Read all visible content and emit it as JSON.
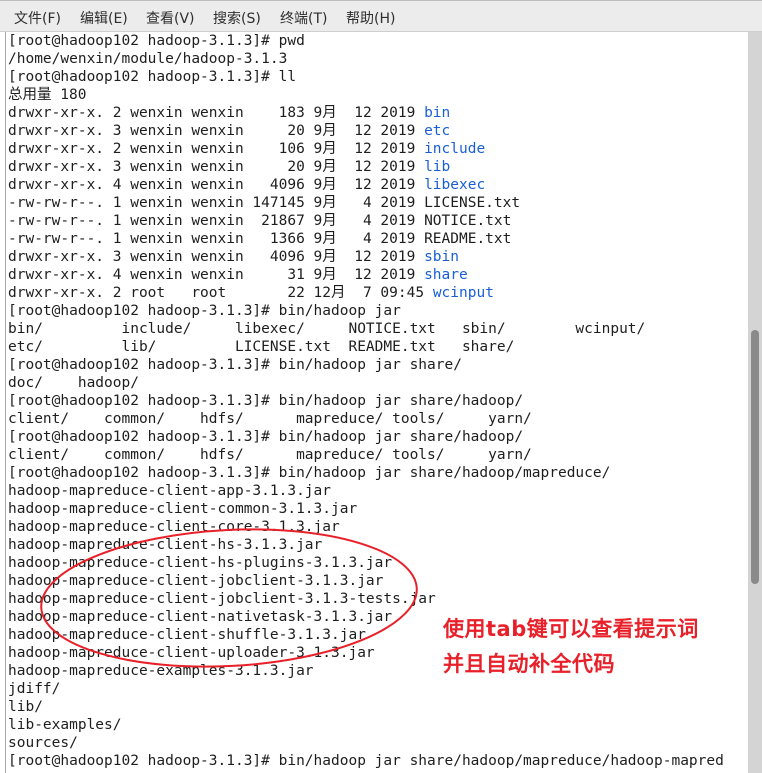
{
  "menu": [
    "文件(F)",
    "编辑(E)",
    "查看(V)",
    "搜索(S)",
    "终端(T)",
    "帮助(H)"
  ],
  "terminal_lines": [
    [
      {
        "t": "[root@hadoop102 hadoop-3.1.3]# pwd"
      }
    ],
    [
      {
        "t": "/home/wenxin/module/hadoop-3.1.3"
      }
    ],
    [
      {
        "t": "[root@hadoop102 hadoop-3.1.3]# ll"
      }
    ],
    [
      {
        "t": "总用量 180"
      }
    ],
    [
      {
        "t": "drwxr-xr-x. 2 wenxin wenxin    183 9月  12 2019 "
      },
      {
        "t": "bin",
        "c": "blue"
      }
    ],
    [
      {
        "t": "drwxr-xr-x. 3 wenxin wenxin     20 9月  12 2019 "
      },
      {
        "t": "etc",
        "c": "blue"
      }
    ],
    [
      {
        "t": "drwxr-xr-x. 2 wenxin wenxin    106 9月  12 2019 "
      },
      {
        "t": "include",
        "c": "blue"
      }
    ],
    [
      {
        "t": "drwxr-xr-x. 3 wenxin wenxin     20 9月  12 2019 "
      },
      {
        "t": "lib",
        "c": "blue"
      }
    ],
    [
      {
        "t": "drwxr-xr-x. 4 wenxin wenxin   4096 9月  12 2019 "
      },
      {
        "t": "libexec",
        "c": "blue"
      }
    ],
    [
      {
        "t": "-rw-rw-r--. 1 wenxin wenxin 147145 9月   4 2019 LICENSE.txt"
      }
    ],
    [
      {
        "t": "-rw-rw-r--. 1 wenxin wenxin  21867 9月   4 2019 NOTICE.txt"
      }
    ],
    [
      {
        "t": "-rw-rw-r--. 1 wenxin wenxin   1366 9月   4 2019 README.txt"
      }
    ],
    [
      {
        "t": "drwxr-xr-x. 3 wenxin wenxin   4096 9月  12 2019 "
      },
      {
        "t": "sbin",
        "c": "blue"
      }
    ],
    [
      {
        "t": "drwxr-xr-x. 4 wenxin wenxin     31 9月  12 2019 "
      },
      {
        "t": "share",
        "c": "blue"
      }
    ],
    [
      {
        "t": "drwxr-xr-x. 2 root   root       22 12月  7 09:45 "
      },
      {
        "t": "wcinput",
        "c": "blue"
      }
    ],
    [
      {
        "t": "[root@hadoop102 hadoop-3.1.3]# bin/hadoop jar"
      }
    ],
    [
      {
        "t": "bin/         include/     libexec/     NOTICE.txt   sbin/        wcinput/"
      }
    ],
    [
      {
        "t": "etc/         lib/         LICENSE.txt  README.txt   share/"
      }
    ],
    [
      {
        "t": "[root@hadoop102 hadoop-3.1.3]# bin/hadoop jar share/"
      }
    ],
    [
      {
        "t": "doc/    hadoop/"
      }
    ],
    [
      {
        "t": "[root@hadoop102 hadoop-3.1.3]# bin/hadoop jar share/hadoop/"
      }
    ],
    [
      {
        "t": "client/    common/    hdfs/      mapreduce/ tools/     yarn/"
      }
    ],
    [
      {
        "t": "[root@hadoop102 hadoop-3.1.3]# bin/hadoop jar share/hadoop/"
      }
    ],
    [
      {
        "t": "client/    common/    hdfs/      mapreduce/ tools/     yarn/"
      }
    ],
    [
      {
        "t": "[root@hadoop102 hadoop-3.1.3]# bin/hadoop jar share/hadoop/mapreduce/"
      }
    ],
    [
      {
        "t": "hadoop-mapreduce-client-app-3.1.3.jar"
      }
    ],
    [
      {
        "t": "hadoop-mapreduce-client-common-3.1.3.jar"
      }
    ],
    [
      {
        "t": "hadoop-mapreduce-client-core-3.1.3.jar"
      }
    ],
    [
      {
        "t": "hadoop-mapreduce-client-hs-3.1.3.jar"
      }
    ],
    [
      {
        "t": "hadoop-mapreduce-client-hs-plugins-3.1.3.jar"
      }
    ],
    [
      {
        "t": "hadoop-mapreduce-client-jobclient-3.1.3.jar"
      }
    ],
    [
      {
        "t": "hadoop-mapreduce-client-jobclient-3.1.3-tests.jar"
      }
    ],
    [
      {
        "t": "hadoop-mapreduce-client-nativetask-3.1.3.jar"
      }
    ],
    [
      {
        "t": "hadoop-mapreduce-client-shuffle-3.1.3.jar"
      }
    ],
    [
      {
        "t": "hadoop-mapreduce-client-uploader-3.1.3.jar"
      }
    ],
    [
      {
        "t": "hadoop-mapreduce-examples-3.1.3.jar"
      }
    ],
    [
      {
        "t": "jdiff/"
      }
    ],
    [
      {
        "t": "lib/"
      }
    ],
    [
      {
        "t": "lib-examples/"
      }
    ],
    [
      {
        "t": "sources/"
      }
    ],
    [
      {
        "t": "[root@hadoop102 hadoop-3.1.3]# bin/hadoop jar share/hadoop/mapreduce/hadoop-mapred"
      }
    ]
  ],
  "annotation": {
    "line1": "使用tab键可以查看提示词",
    "line2": "并且自动补全代码",
    "color": "#e8202a"
  },
  "colors": {
    "directory": "#1a5fd6",
    "text": "#1e1e1e"
  }
}
